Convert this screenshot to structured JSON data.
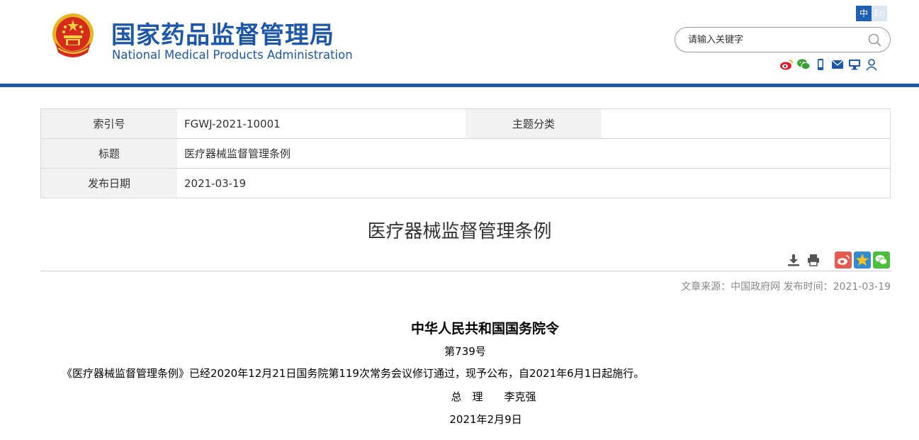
{
  "header": {
    "title_cn": "国家药品监督管理局",
    "title_en": "National Medical Products Administration",
    "lang_zh": "中",
    "lang_en": "En",
    "search_placeholder": "请输入关键字",
    "brand_color": "#1c57a8",
    "social_icons": [
      "weibo-icon",
      "wechat-icon",
      "mobile-icon",
      "mail-icon",
      "monitor-icon",
      "user-icon"
    ]
  },
  "info_table": {
    "index_label": "索引号",
    "index_value": "FGWJ-2021-10001",
    "category_label": "主题分类",
    "category_value": "",
    "title_label": "标题",
    "title_value": "医疗器械监督管理条例",
    "date_label": "发布日期",
    "date_value": "2021-03-19"
  },
  "article": {
    "title": "医疗器械监督管理条例",
    "tools": [
      "download-icon",
      "print-icon",
      "weibo-share-icon",
      "qzone-share-icon",
      "wechat-share-icon"
    ],
    "meta": "文章来源：中国政府网 发布时间：2021-03-19",
    "order_title": "中华人民共和国国务院令",
    "order_no": "第739号",
    "order_text": "《医疗器械监督管理条例》已经2020年12月21日国务院第119次常务会议修订通过，现予公布，自2021年6月1日起施行。",
    "order_sign": "总　理　　李克强",
    "order_date": "2021年2月9日"
  }
}
